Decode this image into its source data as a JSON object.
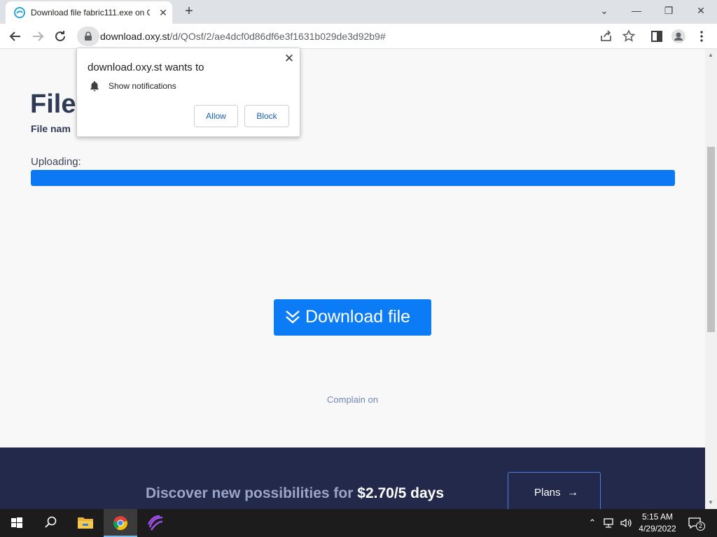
{
  "browser": {
    "tab_title": "Download file fabric111.exe on O",
    "tab_close": "✕",
    "new_tab": "+",
    "url_host": "download.oxy.st",
    "url_path": "/d/QOsf/2/ae4dcf0d86df6e3f1631b029de3d92b9#",
    "window_controls": {
      "dropdown": "⌄",
      "minimize": "—",
      "restore": "❐",
      "close": "✕"
    }
  },
  "popup": {
    "title": "download.oxy.st wants to",
    "permission": "Show notifications",
    "allow": "Allow",
    "block": "Block",
    "close": "✕"
  },
  "page": {
    "title": "File",
    "file_name_label": "File nam",
    "uploading_label": "Uploading:",
    "progress_percent": 100,
    "download_button": "Download file",
    "complain_link": "Complain on"
  },
  "banner": {
    "text": "Discover new possibilities for ",
    "price": "$2.70/5 days",
    "plans_button": "Plans",
    "plans_arrow": "→"
  },
  "taskbar": {
    "time": "5:15 AM",
    "date": "4/29/2022",
    "notifications_count": "2"
  },
  "colors": {
    "accent": "#0b7cf5",
    "banner_bg": "#23294a",
    "title_text": "#2f3a56"
  }
}
